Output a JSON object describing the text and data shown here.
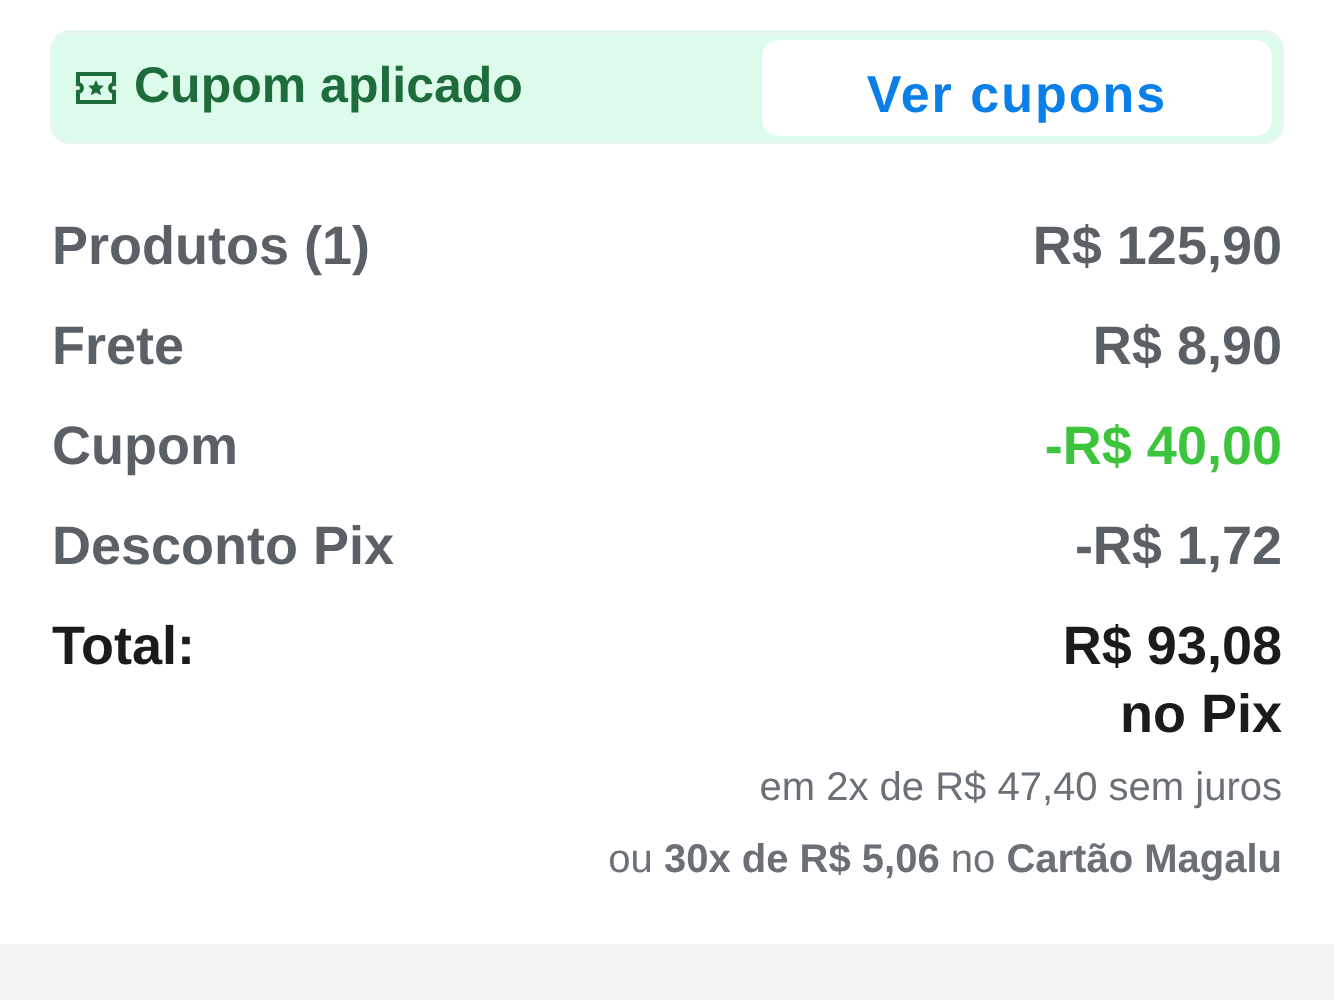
{
  "coupon_bar": {
    "label": "Cupom aplicado",
    "button": "Ver cupons"
  },
  "summary": [
    {
      "label": "Produtos (1)",
      "value": "R$ 125,90",
      "kind": "normal"
    },
    {
      "label": "Frete",
      "value": "R$ 8,90",
      "kind": "normal"
    },
    {
      "label": "Cupom",
      "value": "-R$ 40,00",
      "kind": "coupon"
    },
    {
      "label": "Desconto Pix",
      "value": "-R$ 1,72",
      "kind": "normal"
    }
  ],
  "total": {
    "label": "Total:",
    "value": "R$ 93,08",
    "method": "no Pix"
  },
  "installments": [
    "em 2x de R$ 47,40 sem juros",
    "ou **30x de R$ 5,06** no **Cartão Magalu**"
  ]
}
